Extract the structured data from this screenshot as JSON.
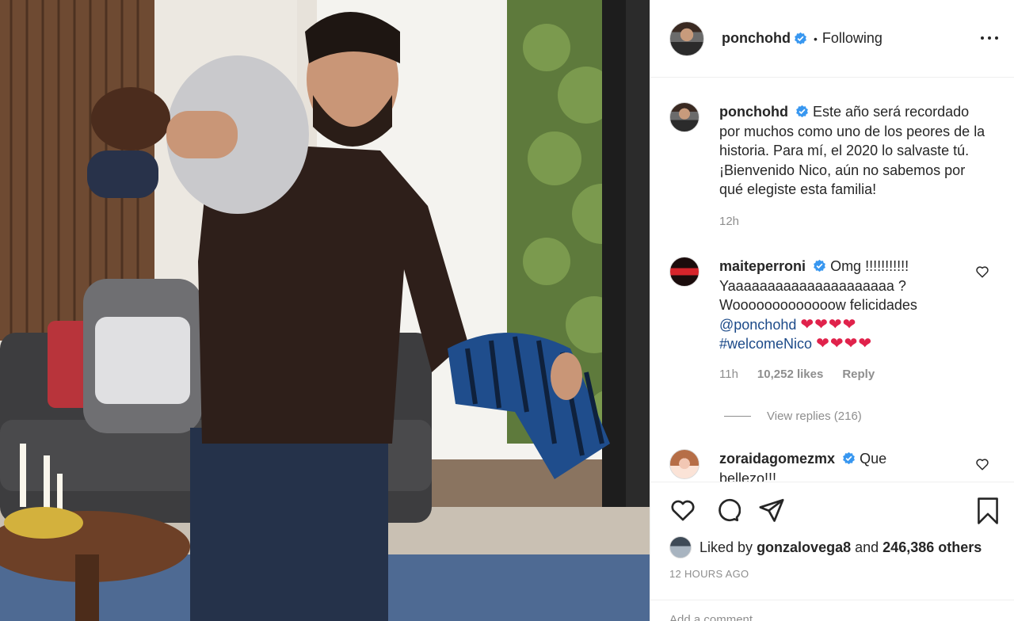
{
  "post": {
    "username": "ponchohd",
    "follow_status": "Following",
    "caption": "Este año será recordado por muchos como uno de los peores de la historia. Para mí, el 2020 lo salvaste tú. ¡Bienvenido Nico, aún no sabemos por qué elegiste esta familia!",
    "caption_time": "12h",
    "liked_by_prefix": "Liked by",
    "liked_by_user": "gonzalovega8",
    "liked_by_and": "and",
    "liked_by_others": "246,386 others",
    "timestamp": "12 HOURS AGO",
    "add_comment_placeholder": "Add a comment…"
  },
  "comments": [
    {
      "username": "maiteperroni",
      "text_line1": "Omg !!!!!!!!!!!",
      "text_line2": "Yaaaaaaaaaaaaaaaaaaaaa ?",
      "text_line3": "Wooooooooooooow felicidades",
      "mention": "@ponchohd",
      "hashtag": "#welcomeNico",
      "hearts_a": "❤❤❤❤",
      "hearts_b": "❤❤❤❤",
      "time": "11h",
      "likes": "10,252 likes",
      "reply": "Reply",
      "view_replies": "View replies (216)"
    },
    {
      "username": "zoraidagomezmx",
      "text": "Que",
      "text_cut": "bellezo!!!"
    }
  ],
  "icons": [
    "more-icon",
    "verified-icon",
    "heart-icon",
    "comment-icon",
    "share-icon",
    "bookmark-icon"
  ],
  "colors": {
    "verified": "#3897f0",
    "mention": "#1c4a89",
    "heart": "#e0224b",
    "muted": "#8e8e8e"
  }
}
